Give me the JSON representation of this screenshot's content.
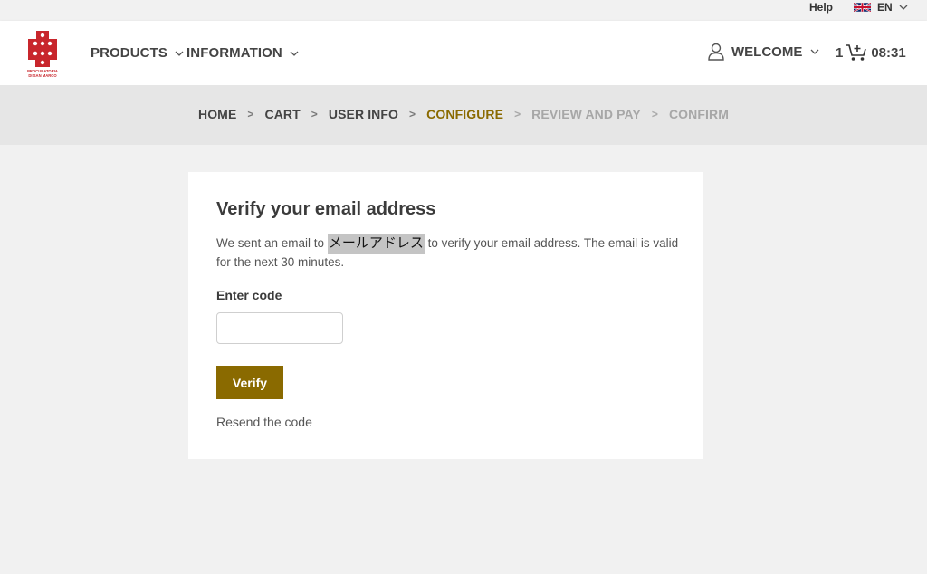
{
  "topbar": {
    "help_label": "Help",
    "language": "EN"
  },
  "header": {
    "logo_text_line1": "PROCURATORIA",
    "logo_text_line2": "DI SAN MARCO",
    "nav": [
      {
        "label": "PRODUCTS"
      },
      {
        "label": "INFORMATION"
      }
    ],
    "welcome_label": "WELCOME",
    "cart_count": "1",
    "timer": "08:31"
  },
  "breadcrumb": {
    "steps": [
      {
        "label": "HOME",
        "state": "done"
      },
      {
        "label": "CART",
        "state": "done"
      },
      {
        "label": "USER INFO",
        "state": "done"
      },
      {
        "label": "CONFIGURE",
        "state": "active"
      },
      {
        "label": "REVIEW AND PAY",
        "state": "future"
      },
      {
        "label": "CONFIRM",
        "state": "future"
      }
    ],
    "separator": ">"
  },
  "verify": {
    "title": "Verify your email address",
    "desc_prefix": "We sent an email to ",
    "email": "メールアドレス",
    "desc_suffix": " to verify your email address. The email is valid for the next 30 minutes.",
    "code_label": "Enter code",
    "code_value": "",
    "verify_button": "Verify",
    "resend_link": "Resend the code"
  },
  "colors": {
    "accent": "#8a6a00",
    "logo_red": "#c8262c",
    "background": "#f1f1f1",
    "band": "#e6e6e6"
  },
  "icons": [
    "uk-flag-icon",
    "chevron-down-icon",
    "user-icon",
    "cart-plus-icon"
  ]
}
